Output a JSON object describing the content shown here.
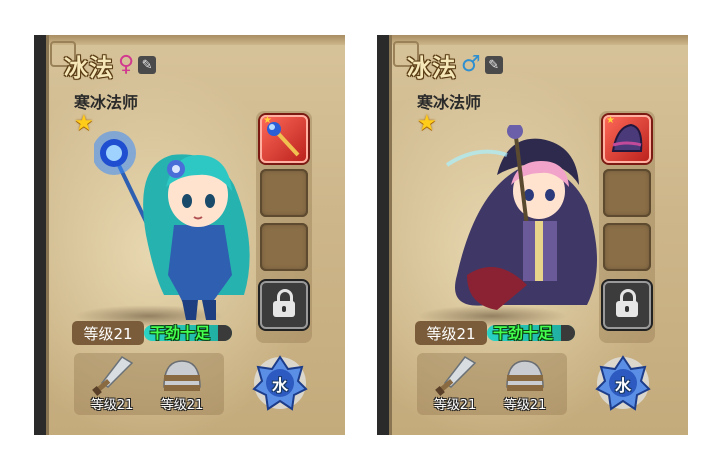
{
  "cards": [
    {
      "class_name": "冰法",
      "gender_symbol": "♀",
      "subtitle": "寒冰法师",
      "level": "等级21",
      "status": "干劲十足",
      "weapon_level": "等级21",
      "helmet_level": "等级21",
      "element": "水"
    },
    {
      "class_name": "冰法",
      "gender_symbol": "♂",
      "subtitle": "寒冰法师",
      "level": "等级21",
      "status": "干劲十足",
      "weapon_level": "等级21",
      "helmet_level": "等级21",
      "element": "水"
    }
  ],
  "icons": {
    "edit": "edit-icon",
    "star": "star-icon",
    "lock": "lock-icon",
    "sword": "sword-icon",
    "helmet": "helmet-icon",
    "element": "water-element-icon"
  },
  "colors": {
    "parchment": "#cdb68a",
    "status_text": "#43ff4f",
    "status_bar": "#29d3c4",
    "female": "#d23a8f",
    "male": "#2f8fcf",
    "equip_slot": "#d9362c"
  }
}
